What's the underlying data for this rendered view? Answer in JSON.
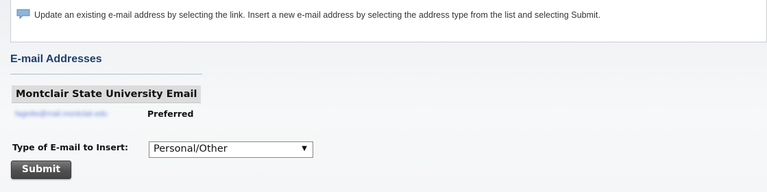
{
  "info": {
    "icon": "speech-bubble-icon",
    "text": "Update an existing e-mail address by selecting the link. Insert a new e-mail address by selecting the address type from the list and selecting Submit."
  },
  "section": {
    "title": "E-mail Addresses",
    "table_header": "Montclair State University Email",
    "email": "fagiolie@mail.montclair.edu",
    "email_status": "Preferred"
  },
  "insert": {
    "label": "Type of E-mail to Insert:",
    "selected": "Personal/Other",
    "arrow": "▼",
    "submit_label": "Submit"
  },
  "colors": {
    "accent": "#1c3f6e",
    "link": "#4a6fd8"
  }
}
